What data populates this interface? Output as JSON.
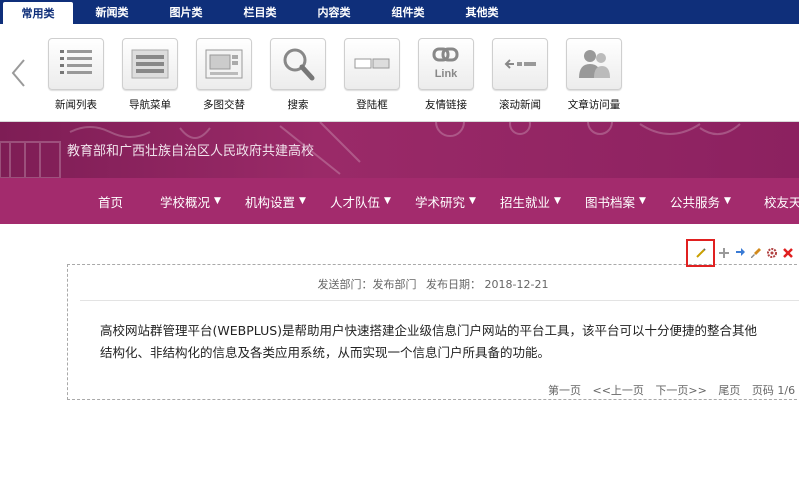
{
  "tabs": [
    {
      "label": "常用类",
      "active": true
    },
    {
      "label": "新闻类",
      "active": false
    },
    {
      "label": "图片类",
      "active": false
    },
    {
      "label": "栏目类",
      "active": false
    },
    {
      "label": "内容类",
      "active": false
    },
    {
      "label": "组件类",
      "active": false
    },
    {
      "label": "其他类",
      "active": false
    }
  ],
  "toolbar": {
    "items": [
      {
        "label": "新闻列表",
        "icon": "news-list-icon"
      },
      {
        "label": "导航菜单",
        "icon": "nav-menu-icon"
      },
      {
        "label": "多图交替",
        "icon": "multi-image-icon"
      },
      {
        "label": "搜索",
        "icon": "search-icon"
      },
      {
        "label": "登陆框",
        "icon": "login-box-icon"
      },
      {
        "label": "友情链接",
        "icon": "link-icon"
      },
      {
        "label": "滚动新闻",
        "icon": "scroll-news-icon"
      },
      {
        "label": "文章访问量",
        "icon": "visitors-icon"
      }
    ]
  },
  "banner": {
    "subtitle": "教育部和广西壮族自治区人民政府共建高校"
  },
  "nav": {
    "items": [
      {
        "label": "首页",
        "dropdown": false
      },
      {
        "label": "学校概况",
        "dropdown": true
      },
      {
        "label": "机构设置",
        "dropdown": true
      },
      {
        "label": "人才队伍",
        "dropdown": true
      },
      {
        "label": "学术研究",
        "dropdown": true
      },
      {
        "label": "招生就业",
        "dropdown": true
      },
      {
        "label": "图书档案",
        "dropdown": true
      },
      {
        "label": "公共服务",
        "dropdown": true
      },
      {
        "label": "校友天",
        "dropdown": false
      }
    ]
  },
  "article": {
    "meta_dept": "发送部门：发布部门",
    "meta_date": "发布日期：  2018-12-21",
    "body": "高校网站群管理平台(WEBPLUS)是帮助用户快速搭建企业级信息门户网站的平台工具，该平台可以十分便捷的整合其他结构化、非结构化的信息及各类应用系统，从而实现一个信息门户所具备的功能。"
  },
  "pager": {
    "first": "第一页",
    "prev": "<<上一页",
    "next": "下一页>>",
    "last": "尾页",
    "page_info": "页码 1/6"
  },
  "colors": {
    "tabbar": "#0f2f7a",
    "banner": "#8c2160",
    "nav": "#a32b6d",
    "highlight": "#e02020"
  }
}
